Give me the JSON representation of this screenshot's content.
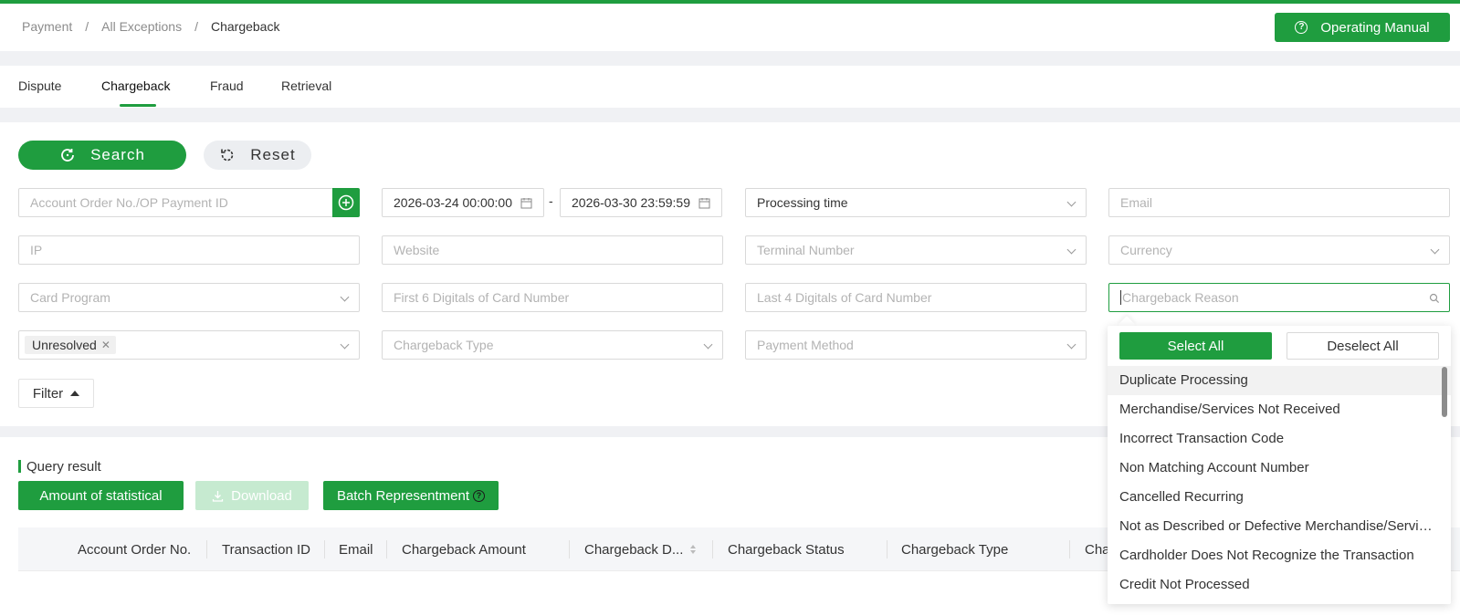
{
  "breadcrumb": [
    "Payment",
    "All Exceptions",
    "Chargeback"
  ],
  "header": {
    "manual_label": "Operating Manual"
  },
  "tabs": [
    {
      "label": "Dispute"
    },
    {
      "label": "Chargeback"
    },
    {
      "label": "Fraud"
    },
    {
      "label": "Retrieval"
    }
  ],
  "actions": {
    "search_label": "Search",
    "reset_label": "Reset"
  },
  "filters": {
    "order_placeholder": "Account Order No./OP Payment ID",
    "date_start": "2026-03-24 00:00:00",
    "date_separator": "-",
    "date_end": "2026-03-30 23:59:59",
    "time_type": "Processing time",
    "email_placeholder": "Email",
    "ip_placeholder": "IP",
    "website_placeholder": "Website",
    "terminal_placeholder": "Terminal Number",
    "currency_placeholder": "Currency",
    "card_program_placeholder": "Card Program",
    "first6_placeholder": "First 6 Digitals of Card Number",
    "last4_placeholder": "Last 4 Digitals of Card Number",
    "reason_placeholder": "Chargeback Reason",
    "status_tag": "Unresolved",
    "type_placeholder": "Chargeback Type",
    "payment_method_placeholder": "Payment Method",
    "filter_toggle_label": "Filter"
  },
  "results": {
    "title": "Query result",
    "amount_label": "Amount of statistical",
    "download_label": "Download",
    "batch_label": "Batch Representment"
  },
  "table": {
    "columns": [
      "Account Order No.",
      "Transaction ID",
      "Email",
      "Chargeback Amount",
      "Chargeback D...",
      "Chargeback Status",
      "Chargeback Type",
      "Cha"
    ]
  },
  "dropdown": {
    "select_all": "Select All",
    "deselect_all": "Deselect All",
    "items": [
      "Duplicate Processing",
      "Merchandise/Services Not Received",
      "Incorrect Transaction Code",
      "Non Matching Account Number",
      "Cancelled Recurring",
      "Not as Described or Defective Merchandise/Services",
      "Cardholder Does Not Recognize the Transaction",
      "Credit Not Processed"
    ]
  },
  "colors": {
    "accent": "#1f9d3f",
    "accent_disabled": "#c6ead0"
  }
}
